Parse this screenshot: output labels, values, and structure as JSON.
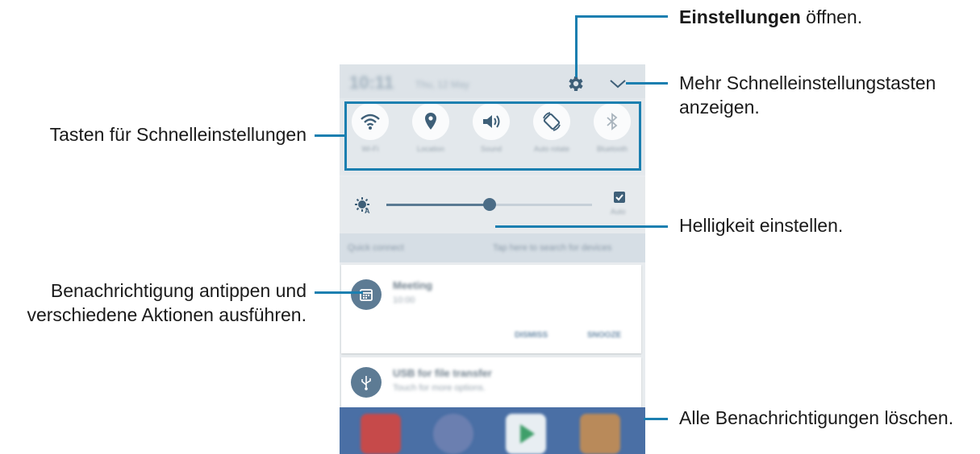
{
  "phone": {
    "time": "10:11",
    "date": "Thu, 12 May",
    "quick_tiles": [
      {
        "icon": "wifi-icon",
        "label": "Wi-Fi"
      },
      {
        "icon": "location-icon",
        "label": "Location"
      },
      {
        "icon": "sound-icon",
        "label": "Sound"
      },
      {
        "icon": "auto-rotate-icon",
        "label": "Auto rotate"
      },
      {
        "icon": "bluetooth-icon",
        "label": "Bluetooth"
      }
    ],
    "brightness_level": 0.5,
    "brightness_auto_label": "Auto",
    "smart_bar": {
      "left": "Quick connect",
      "right": "Tap here to search for devices"
    },
    "notifications": [
      {
        "title": "Meeting",
        "subtitle": "10:00",
        "action_1": "DISMISS",
        "action_2": "SNOOZE"
      },
      {
        "title": "USB for file transfer",
        "subtitle": "Touch for more options."
      }
    ]
  },
  "callouts": {
    "settings_bold": "Einstellungen",
    "settings_rest": " öffnen.",
    "more_line1": "Mehr Schnelleinstellungstasten",
    "more_line2": "anzeigen.",
    "quick_buttons": "Tasten für Schnelleinstellungen",
    "brightness": "Helligkeit einstellen.",
    "notif_line1": "Benachrichtigung antippen und",
    "notif_line2": "verschiedene Aktionen ausführen.",
    "clear_all": "Alle Benachrichtigungen löschen."
  },
  "colors": {
    "callout_line": "#1b7fb0",
    "icon_blue": "#3e5f78"
  }
}
